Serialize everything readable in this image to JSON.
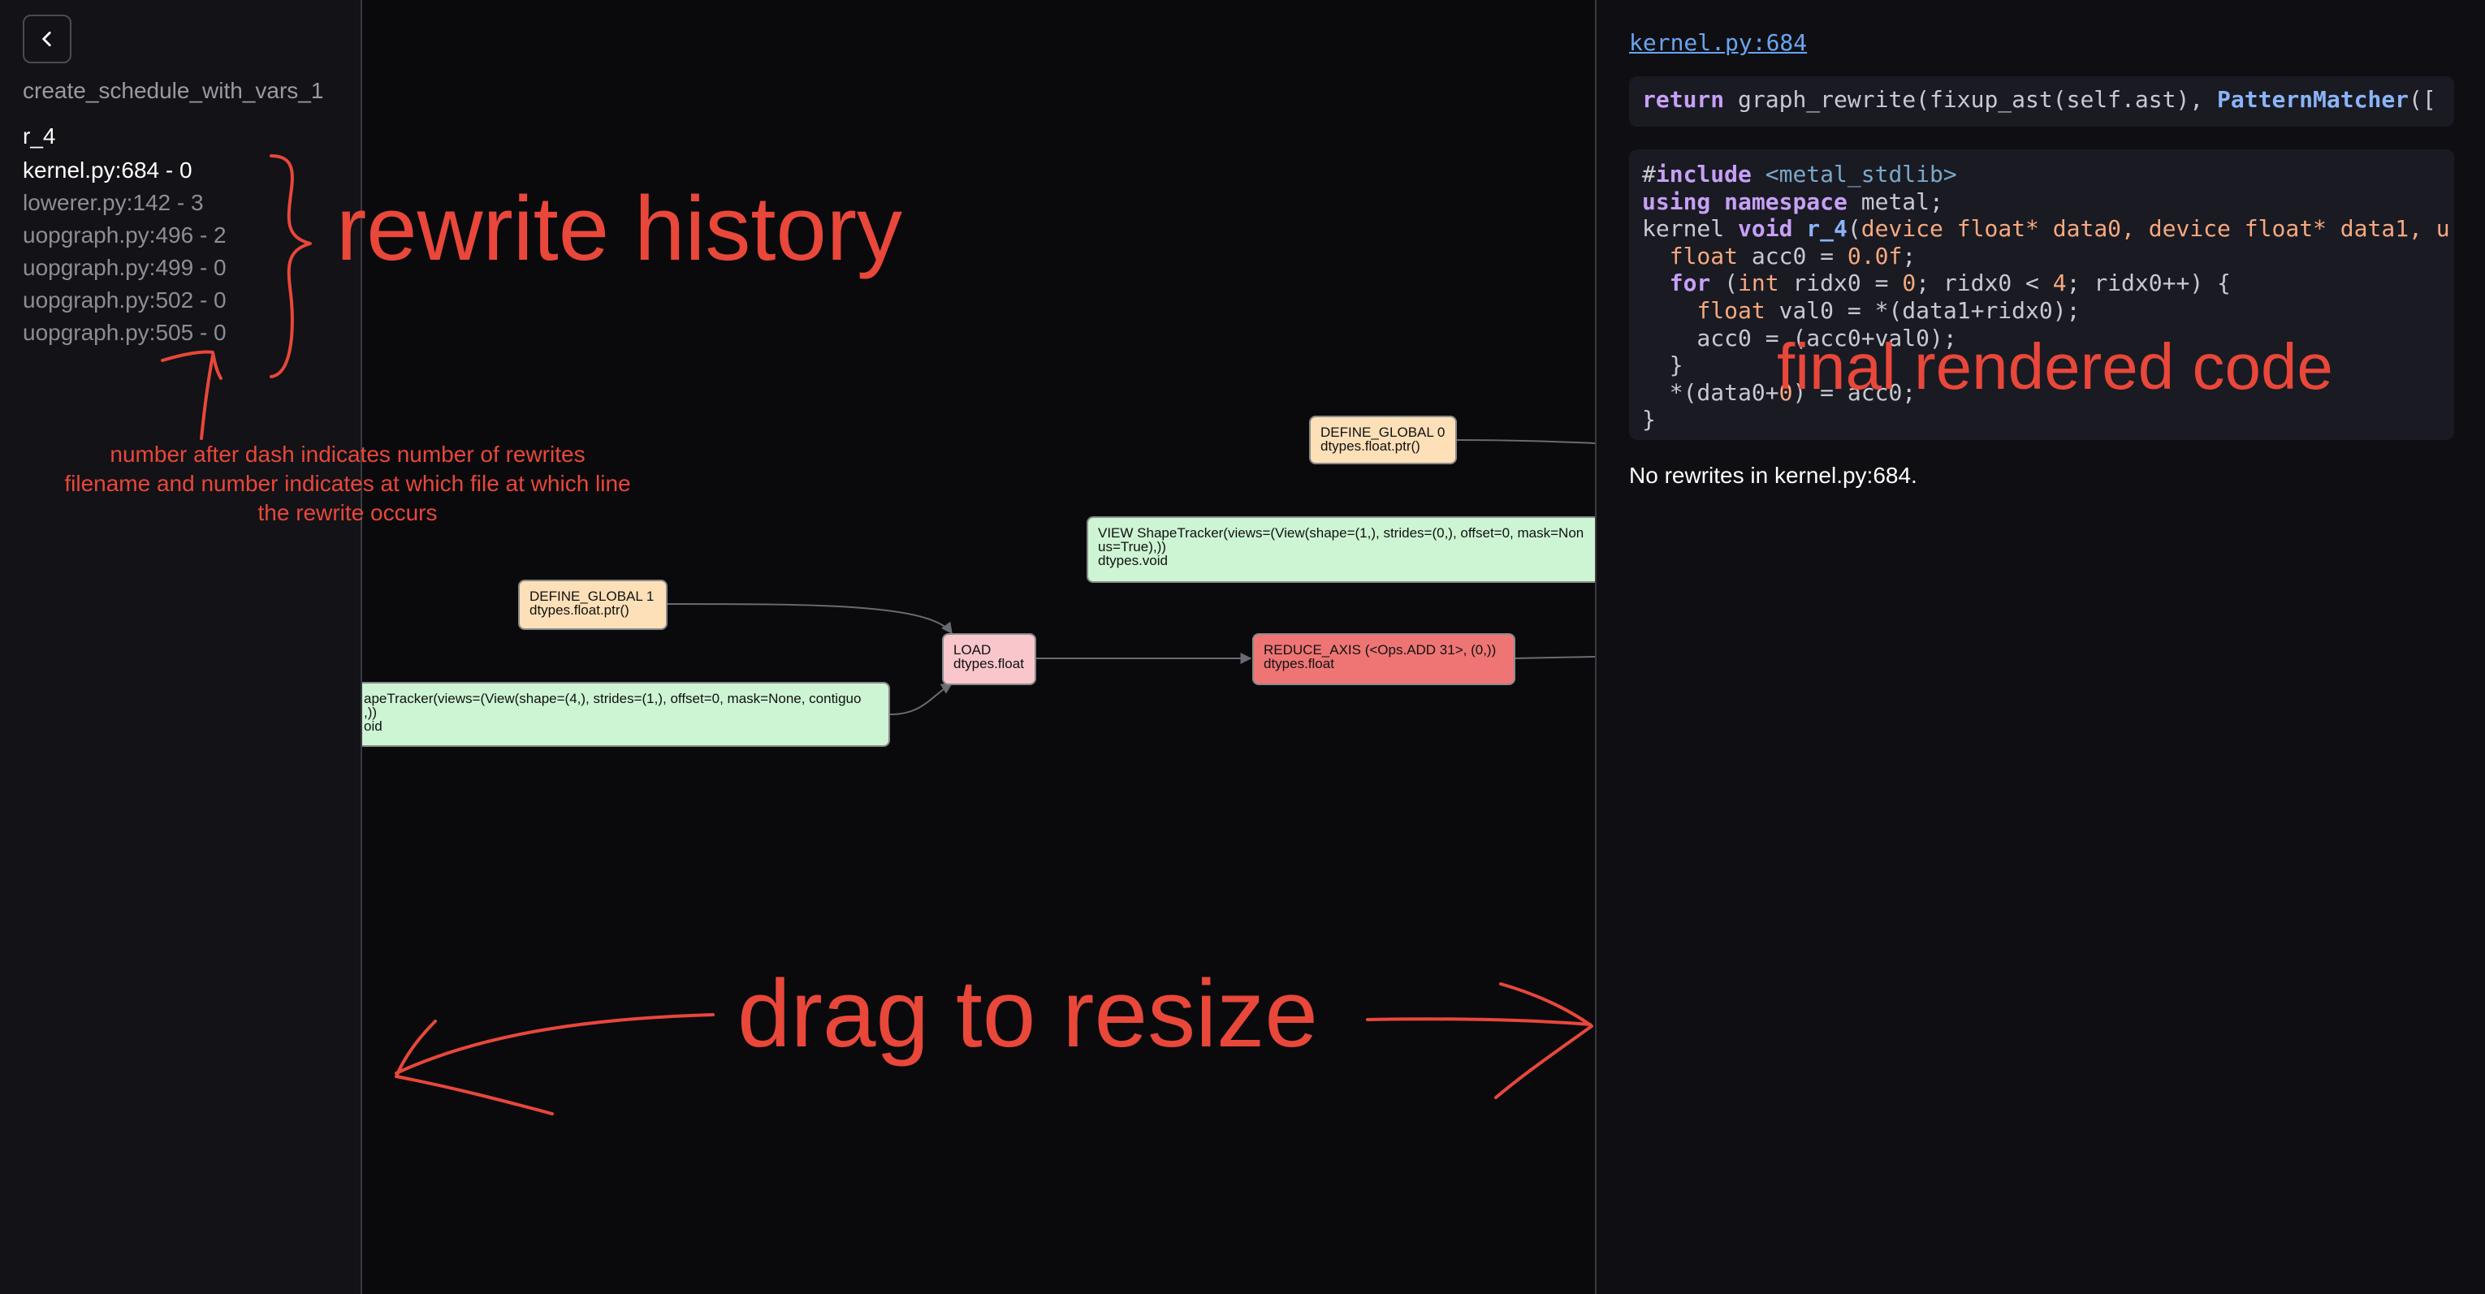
{
  "sidebar": {
    "back_icon": "chevron-left-icon",
    "schedule_title": "create_schedule_with_vars_1",
    "kernel_name": "r_4",
    "history": [
      {
        "label": "kernel.py:684 - 0",
        "active": true
      },
      {
        "label": "lowerer.py:142 - 3",
        "active": false
      },
      {
        "label": "uopgraph.py:496 - 2",
        "active": false
      },
      {
        "label": "uopgraph.py:499 - 0",
        "active": false
      },
      {
        "label": "uopgraph.py:502 - 0",
        "active": false
      },
      {
        "label": "uopgraph.py:505 - 0",
        "active": false
      }
    ]
  },
  "graph": {
    "nodes": {
      "define_global_0": {
        "line1": "DEFINE_GLOBAL 0",
        "line2": "dtypes.float.ptr()"
      },
      "define_global_1": {
        "line1": "DEFINE_GLOBAL 1",
        "line2": "dtypes.float.ptr()"
      },
      "view_top": {
        "line1": "VIEW ShapeTracker(views=(View(shape=(1,), strides=(0,), offset=0, mask=Non",
        "line2": "us=True),))",
        "line3": "dtypes.void"
      },
      "view_left": {
        "line1": "apeTracker(views=(View(shape=(4,), strides=(1,), offset=0, mask=None, contiguo",
        "line2": ",))",
        "line3": "oid"
      },
      "load": {
        "line1": "LOAD",
        "line2": "dtypes.float"
      },
      "reduce_axis": {
        "line1": "REDUCE_AXIS (<Ops.ADD 31>, (0,))",
        "line2": "dtypes.float"
      }
    },
    "colors": {
      "define_global": "#fde0b8",
      "view": "#cdf5d4",
      "load": "#f9c6cc",
      "reduce": "#ef7575",
      "edge": "#6a6a72"
    }
  },
  "right_panel": {
    "source_link": "kernel.py:684",
    "source_line": {
      "kw": "return",
      "mid": " graph_rewrite(fixup_ast(self.ast), ",
      "fn": "PatternMatcher",
      "tail": "(["
    },
    "code": {
      "l1_hash": "#",
      "l1_kw": "include",
      "l1_str": " <metal_stdlib>",
      "l2_kw1": "using",
      "l2_kw2": " namespace",
      "l2_rest": " metal;",
      "l3_a": "kernel ",
      "l3_kw": "void",
      "l3_fn": " r_4",
      "l3_b": "(",
      "l3_c": "device float* data0, device float* data1, u",
      "l4_a": "  ",
      "l4_ty": "float",
      "l4_b": " acc0 = ",
      "l4_num": "0.0f",
      "l4_c": ";",
      "l5_a": "  ",
      "l5_kw": "for",
      "l5_b": " (",
      "l5_ty": "int",
      "l5_c": " ridx0 = ",
      "l5_n1": "0",
      "l5_d": "; ridx0 < ",
      "l5_n2": "4",
      "l5_e": "; ridx0++) {",
      "l6_a": "    ",
      "l6_ty": "float",
      "l6_b": " val0 = *(data1+ridx0);",
      "l7": "    acc0 = (acc0+val0);",
      "l8": "  }",
      "l9_a": "  *(data0+",
      "l9_n": "0",
      "l9_b": ") = acc0;",
      "l10": "}"
    },
    "no_rewrites": "No rewrites in kernel.py:684."
  },
  "annotations": {
    "rewrite_history": "rewrite history",
    "final_code": "final rendered code",
    "drag_resize": "drag to resize",
    "note_line1": "number after dash indicates number of rewrites",
    "note_line2": "filename and number indicates at which file at which line",
    "note_line3": "the rewrite occurs",
    "color": "#e8473a"
  }
}
